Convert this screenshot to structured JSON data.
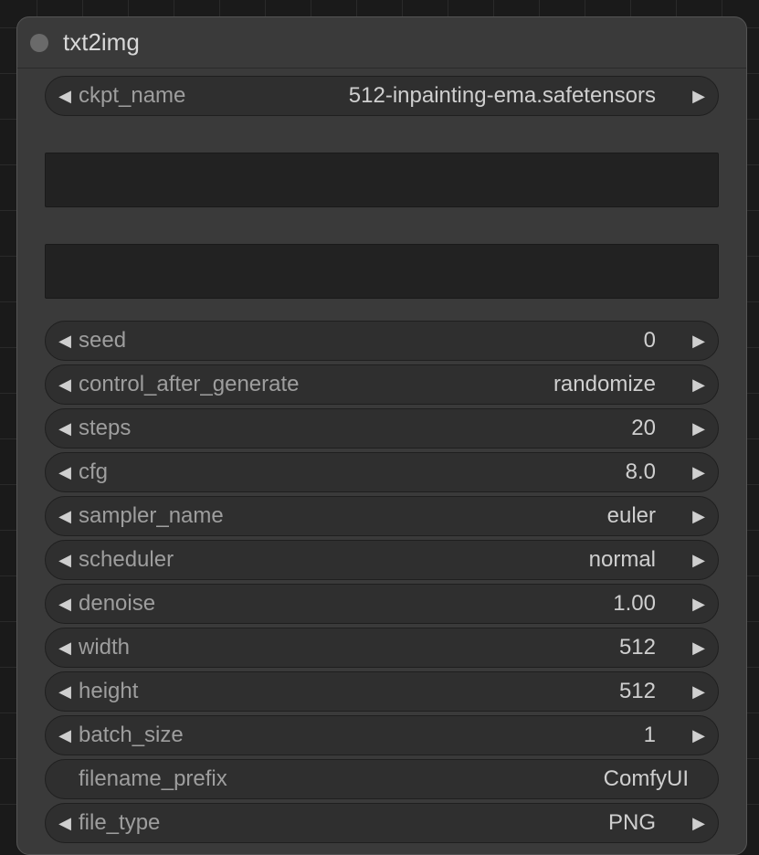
{
  "node": {
    "title": "txt2img"
  },
  "widgets": {
    "ckpt_name": {
      "label": "ckpt_name",
      "value": "512-inpainting-ema.safetensors"
    },
    "seed": {
      "label": "seed",
      "value": "0"
    },
    "control_after_generate": {
      "label": "control_after_generate",
      "value": "randomize"
    },
    "steps": {
      "label": "steps",
      "value": "20"
    },
    "cfg": {
      "label": "cfg",
      "value": "8.0"
    },
    "sampler_name": {
      "label": "sampler_name",
      "value": "euler"
    },
    "scheduler": {
      "label": "scheduler",
      "value": "normal"
    },
    "denoise": {
      "label": "denoise",
      "value": "1.00"
    },
    "width": {
      "label": "width",
      "value": "512"
    },
    "height": {
      "label": "height",
      "value": "512"
    },
    "batch_size": {
      "label": "batch_size",
      "value": "1"
    },
    "filename_prefix": {
      "label": "filename_prefix",
      "value": "ComfyUI"
    },
    "file_type": {
      "label": "file_type",
      "value": "PNG"
    }
  }
}
